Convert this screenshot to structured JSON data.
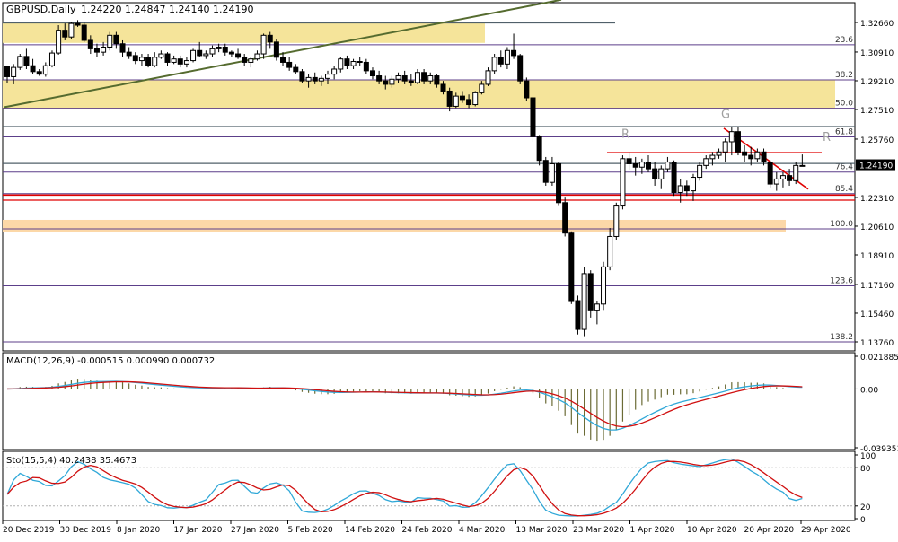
{
  "header": {
    "symbol_timeframe": "GBPUSD,Daily",
    "ohlc": "1.24220 1.24847 1.24140 1.24190"
  },
  "chart_data": [
    {
      "type": "candlestick",
      "name": "price",
      "ylim": [
        1.1376,
        1.3266
      ],
      "y_ticks": [
        "1.32660",
        "1.30910",
        "1.29210",
        "1.27510",
        "1.25760",
        "1.24190",
        "1.22310",
        "1.20610",
        "1.18910",
        "1.17160",
        "1.15460",
        "1.13760"
      ],
      "current_price": "1.24190",
      "x_ticks": [
        "20 Dec 2019",
        "30 Dec 2019",
        "8 Jan 2020",
        "17 Jan 2020",
        "27 Jan 2020",
        "5 Feb 2020",
        "14 Feb 2020",
        "24 Feb 2020",
        "4 Mar 2020",
        "13 Mar 2020",
        "23 Mar 2020",
        "1 Apr 2020",
        "10 Apr 2020",
        "20 Apr 2020",
        "29 Apr 2020"
      ],
      "fibonacci_levels": [
        {
          "label": "23.6",
          "price": 1.3134
        },
        {
          "label": "38.2",
          "price": 1.2926
        },
        {
          "label": "50.0",
          "price": 1.2758
        },
        {
          "label": "61.8",
          "price": 1.2589
        },
        {
          "label": "76.4",
          "price": 1.2381
        },
        {
          "label": "85.4",
          "price": 1.2253
        },
        {
          "label": "100.0",
          "price": 1.2045
        },
        {
          "label": "123.6",
          "price": 1.1708
        },
        {
          "label": "138.2",
          "price": 1.1376
        }
      ],
      "annotations": [
        "G",
        "R",
        "R"
      ],
      "candles": [
        [
          1.3005,
          1.301,
          1.2905,
          1.2945
        ],
        [
          1.2945,
          1.302,
          1.29,
          1.3
        ],
        [
          1.3,
          1.308,
          1.2985,
          1.3065
        ],
        [
          1.3065,
          1.311,
          1.299,
          1.301
        ],
        [
          1.301,
          1.305,
          1.296,
          1.2975
        ],
        [
          1.2975,
          1.299,
          1.295,
          1.296
        ],
        [
          1.296,
          1.303,
          1.2945,
          1.301
        ],
        [
          1.301,
          1.31,
          1.3,
          1.3085
        ],
        [
          1.3085,
          1.325,
          1.3075,
          1.322
        ],
        [
          1.322,
          1.326,
          1.316,
          1.318
        ],
        [
          1.318,
          1.327,
          1.317,
          1.326
        ],
        [
          1.326,
          1.328,
          1.324,
          1.325
        ],
        [
          1.325,
          1.3265,
          1.315,
          1.316
        ],
        [
          1.316,
          1.319,
          1.308,
          1.311
        ],
        [
          1.311,
          1.314,
          1.306,
          1.309
        ],
        [
          1.309,
          1.315,
          1.307,
          1.312
        ],
        [
          1.312,
          1.321,
          1.31,
          1.319
        ],
        [
          1.319,
          1.321,
          1.311,
          1.314
        ],
        [
          1.314,
          1.316,
          1.306,
          1.309
        ],
        [
          1.309,
          1.312,
          1.305,
          1.307
        ],
        [
          1.307,
          1.309,
          1.302,
          1.304
        ],
        [
          1.304,
          1.308,
          1.301,
          1.306
        ],
        [
          1.306,
          1.308,
          1.3,
          1.301
        ],
        [
          1.301,
          1.309,
          1.3,
          1.306
        ],
        [
          1.306,
          1.31,
          1.305,
          1.308
        ],
        [
          1.308,
          1.309,
          1.301,
          1.303
        ],
        [
          1.303,
          1.307,
          1.302,
          1.305
        ],
        [
          1.305,
          1.307,
          1.3,
          1.302
        ],
        [
          1.302,
          1.306,
          1.3,
          1.304
        ],
        [
          1.304,
          1.311,
          1.303,
          1.31
        ],
        [
          1.31,
          1.315,
          1.306,
          1.307
        ],
        [
          1.307,
          1.31,
          1.305,
          1.308
        ],
        [
          1.308,
          1.313,
          1.306,
          1.311
        ],
        [
          1.311,
          1.314,
          1.309,
          1.312
        ],
        [
          1.312,
          1.314,
          1.307,
          1.309
        ],
        [
          1.309,
          1.31,
          1.306,
          1.308
        ],
        [
          1.308,
          1.311,
          1.305,
          1.306
        ],
        [
          1.306,
          1.308,
          1.301,
          1.303
        ],
        [
          1.303,
          1.306,
          1.3,
          1.305
        ],
        [
          1.305,
          1.31,
          1.304,
          1.308
        ],
        [
          1.308,
          1.32,
          1.305,
          1.319
        ],
        [
          1.319,
          1.321,
          1.311,
          1.315
        ],
        [
          1.315,
          1.317,
          1.304,
          1.306
        ],
        [
          1.306,
          1.309,
          1.301,
          1.303
        ],
        [
          1.303,
          1.306,
          1.298,
          1.3
        ],
        [
          1.3,
          1.302,
          1.296,
          1.2975
        ],
        [
          1.2975,
          1.299,
          1.291,
          1.292
        ],
        [
          1.292,
          1.296,
          1.288,
          1.294
        ],
        [
          1.294,
          1.297,
          1.29,
          1.292
        ],
        [
          1.292,
          1.295,
          1.289,
          1.2935
        ],
        [
          1.2935,
          1.298,
          1.29,
          1.296
        ],
        [
          1.296,
          1.301,
          1.293,
          1.299
        ],
        [
          1.299,
          1.306,
          1.297,
          1.305
        ],
        [
          1.305,
          1.307,
          1.299,
          1.301
        ],
        [
          1.301,
          1.305,
          1.299,
          1.3035
        ],
        [
          1.3035,
          1.306,
          1.301,
          1.303
        ],
        [
          1.303,
          1.305,
          1.296,
          1.298
        ],
        [
          1.298,
          1.3,
          1.293,
          1.295
        ],
        [
          1.295,
          1.298,
          1.29,
          1.292
        ],
        [
          1.292,
          1.295,
          1.287,
          1.29
        ],
        [
          1.29,
          1.295,
          1.288,
          1.293
        ],
        [
          1.293,
          1.297,
          1.291,
          1.295
        ],
        [
          1.295,
          1.298,
          1.29,
          1.292
        ],
        [
          1.292,
          1.296,
          1.289,
          1.291
        ],
        [
          1.291,
          1.299,
          1.29,
          1.297
        ],
        [
          1.297,
          1.299,
          1.29,
          1.292
        ],
        [
          1.292,
          1.297,
          1.29,
          1.295
        ],
        [
          1.295,
          1.296,
          1.288,
          1.29
        ],
        [
          1.29,
          1.292,
          1.284,
          1.286
        ],
        [
          1.286,
          1.288,
          1.274,
          1.277
        ],
        [
          1.277,
          1.285,
          1.276,
          1.283
        ],
        [
          1.283,
          1.286,
          1.279,
          1.281
        ],
        [
          1.281,
          1.284,
          1.276,
          1.278
        ],
        [
          1.278,
          1.286,
          1.277,
          1.285
        ],
        [
          1.285,
          1.292,
          1.284,
          1.29
        ],
        [
          1.29,
          1.3,
          1.289,
          1.298
        ],
        [
          1.298,
          1.308,
          1.296,
          1.306
        ],
        [
          1.306,
          1.31,
          1.3,
          1.302
        ],
        [
          1.302,
          1.312,
          1.299,
          1.31
        ],
        [
          1.31,
          1.32,
          1.305,
          1.307
        ],
        [
          1.307,
          1.308,
          1.29,
          1.292
        ],
        [
          1.292,
          1.294,
          1.28,
          1.282
        ],
        [
          1.282,
          1.283,
          1.256,
          1.259
        ],
        [
          1.259,
          1.26,
          1.242,
          1.245
        ],
        [
          1.245,
          1.247,
          1.23,
          1.232
        ],
        [
          1.232,
          1.247,
          1.23,
          1.243
        ],
        [
          1.243,
          1.244,
          1.218,
          1.22
        ],
        [
          1.22,
          1.223,
          1.2,
          1.202
        ],
        [
          1.202,
          1.203,
          1.16,
          1.162
        ],
        [
          1.162,
          1.165,
          1.142,
          1.145
        ],
        [
          1.145,
          1.182,
          1.141,
          1.178
        ],
        [
          1.178,
          1.18,
          1.152,
          1.156
        ],
        [
          1.156,
          1.162,
          1.148,
          1.16
        ],
        [
          1.16,
          1.185,
          1.156,
          1.182
        ],
        [
          1.182,
          1.205,
          1.18,
          1.2
        ],
        [
          1.2,
          1.22,
          1.198,
          1.218
        ],
        [
          1.218,
          1.248,
          1.216,
          1.246
        ],
        [
          1.246,
          1.25,
          1.239,
          1.243
        ],
        [
          1.243,
          1.247,
          1.236,
          1.241
        ],
        [
          1.241,
          1.246,
          1.237,
          1.244
        ],
        [
          1.244,
          1.248,
          1.238,
          1.24
        ],
        [
          1.24,
          1.244,
          1.23,
          1.234
        ],
        [
          1.234,
          1.242,
          1.228,
          1.24
        ],
        [
          1.24,
          1.247,
          1.238,
          1.244
        ],
        [
          1.244,
          1.245,
          1.224,
          1.226
        ],
        [
          1.226,
          1.234,
          1.22,
          1.23
        ],
        [
          1.23,
          1.233,
          1.224,
          1.227
        ],
        [
          1.227,
          1.237,
          1.221,
          1.235
        ],
        [
          1.235,
          1.244,
          1.233,
          1.242
        ],
        [
          1.242,
          1.248,
          1.24,
          1.246
        ],
        [
          1.246,
          1.25,
          1.242,
          1.248
        ],
        [
          1.248,
          1.252,
          1.246,
          1.25
        ],
        [
          1.25,
          1.258,
          1.244,
          1.256
        ],
        [
          1.256,
          1.265,
          1.248,
          1.262
        ],
        [
          1.262,
          1.265,
          1.248,
          1.25
        ],
        [
          1.25,
          1.254,
          1.244,
          1.248
        ],
        [
          1.248,
          1.253,
          1.242,
          1.246
        ],
        [
          1.246,
          1.252,
          1.244,
          1.25
        ],
        [
          1.25,
          1.252,
          1.242,
          1.244
        ],
        [
          1.244,
          1.245,
          1.229,
          1.231
        ],
        [
          1.231,
          1.238,
          1.227,
          1.234
        ],
        [
          1.234,
          1.238,
          1.229,
          1.236
        ],
        [
          1.236,
          1.24,
          1.23,
          1.233
        ],
        [
          1.233,
          1.244,
          1.231,
          1.242
        ],
        [
          1.242,
          1.2485,
          1.2414,
          1.2419
        ]
      ]
    },
    {
      "type": "histogram+line",
      "name": "MACD",
      "label": "MACD(12,26,9) -0.000515 0.000990 0.000732",
      "y_ticks": [
        "0.021885",
        "0.00",
        "-0.039351"
      ],
      "ylim": [
        -0.039351,
        0.021885
      ]
    },
    {
      "type": "line",
      "name": "Stochastic",
      "label": "Sto(15,5,4) 40.2438 35.4673",
      "y_ticks": [
        "100",
        "80",
        "20",
        "0"
      ],
      "ylim": [
        0,
        100
      ]
    }
  ],
  "colors": {
    "zone_yellow": "#f5e49a",
    "zone_orange": "#fcd8a8",
    "trend_green": "#556b2f",
    "level_red": "#e00000",
    "fib_purple": "#5c3f8a",
    "macd_signal_red": "#d01010",
    "macd_line_blue": "#30a8d8",
    "sto_main_blue": "#30a8d8",
    "sto_signal_red": "#d01010",
    "histogram": "#6b6b35",
    "annotation_gray": "#a0a0a0"
  }
}
